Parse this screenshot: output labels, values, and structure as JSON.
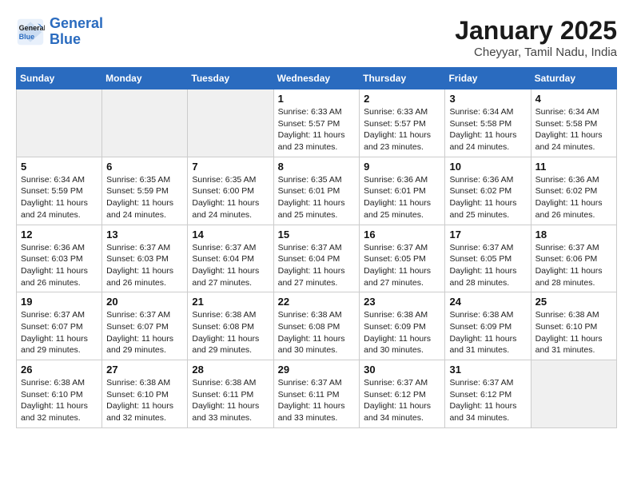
{
  "header": {
    "logo_line1": "General",
    "logo_line2": "Blue",
    "month_title": "January 2025",
    "subtitle": "Cheyyar, Tamil Nadu, India"
  },
  "weekdays": [
    "Sunday",
    "Monday",
    "Tuesday",
    "Wednesday",
    "Thursday",
    "Friday",
    "Saturday"
  ],
  "weeks": [
    [
      {
        "day": "",
        "info": "",
        "shaded": true
      },
      {
        "day": "",
        "info": "",
        "shaded": true
      },
      {
        "day": "",
        "info": "",
        "shaded": true
      },
      {
        "day": "1",
        "info": "Sunrise: 6:33 AM\nSunset: 5:57 PM\nDaylight: 11 hours\nand 23 minutes."
      },
      {
        "day": "2",
        "info": "Sunrise: 6:33 AM\nSunset: 5:57 PM\nDaylight: 11 hours\nand 23 minutes."
      },
      {
        "day": "3",
        "info": "Sunrise: 6:34 AM\nSunset: 5:58 PM\nDaylight: 11 hours\nand 24 minutes."
      },
      {
        "day": "4",
        "info": "Sunrise: 6:34 AM\nSunset: 5:58 PM\nDaylight: 11 hours\nand 24 minutes."
      }
    ],
    [
      {
        "day": "5",
        "info": "Sunrise: 6:34 AM\nSunset: 5:59 PM\nDaylight: 11 hours\nand 24 minutes."
      },
      {
        "day": "6",
        "info": "Sunrise: 6:35 AM\nSunset: 5:59 PM\nDaylight: 11 hours\nand 24 minutes."
      },
      {
        "day": "7",
        "info": "Sunrise: 6:35 AM\nSunset: 6:00 PM\nDaylight: 11 hours\nand 24 minutes."
      },
      {
        "day": "8",
        "info": "Sunrise: 6:35 AM\nSunset: 6:01 PM\nDaylight: 11 hours\nand 25 minutes."
      },
      {
        "day": "9",
        "info": "Sunrise: 6:36 AM\nSunset: 6:01 PM\nDaylight: 11 hours\nand 25 minutes."
      },
      {
        "day": "10",
        "info": "Sunrise: 6:36 AM\nSunset: 6:02 PM\nDaylight: 11 hours\nand 25 minutes."
      },
      {
        "day": "11",
        "info": "Sunrise: 6:36 AM\nSunset: 6:02 PM\nDaylight: 11 hours\nand 26 minutes."
      }
    ],
    [
      {
        "day": "12",
        "info": "Sunrise: 6:36 AM\nSunset: 6:03 PM\nDaylight: 11 hours\nand 26 minutes."
      },
      {
        "day": "13",
        "info": "Sunrise: 6:37 AM\nSunset: 6:03 PM\nDaylight: 11 hours\nand 26 minutes."
      },
      {
        "day": "14",
        "info": "Sunrise: 6:37 AM\nSunset: 6:04 PM\nDaylight: 11 hours\nand 27 minutes."
      },
      {
        "day": "15",
        "info": "Sunrise: 6:37 AM\nSunset: 6:04 PM\nDaylight: 11 hours\nand 27 minutes."
      },
      {
        "day": "16",
        "info": "Sunrise: 6:37 AM\nSunset: 6:05 PM\nDaylight: 11 hours\nand 27 minutes."
      },
      {
        "day": "17",
        "info": "Sunrise: 6:37 AM\nSunset: 6:05 PM\nDaylight: 11 hours\nand 28 minutes."
      },
      {
        "day": "18",
        "info": "Sunrise: 6:37 AM\nSunset: 6:06 PM\nDaylight: 11 hours\nand 28 minutes."
      }
    ],
    [
      {
        "day": "19",
        "info": "Sunrise: 6:37 AM\nSunset: 6:07 PM\nDaylight: 11 hours\nand 29 minutes."
      },
      {
        "day": "20",
        "info": "Sunrise: 6:37 AM\nSunset: 6:07 PM\nDaylight: 11 hours\nand 29 minutes."
      },
      {
        "day": "21",
        "info": "Sunrise: 6:38 AM\nSunset: 6:08 PM\nDaylight: 11 hours\nand 29 minutes."
      },
      {
        "day": "22",
        "info": "Sunrise: 6:38 AM\nSunset: 6:08 PM\nDaylight: 11 hours\nand 30 minutes."
      },
      {
        "day": "23",
        "info": "Sunrise: 6:38 AM\nSunset: 6:09 PM\nDaylight: 11 hours\nand 30 minutes."
      },
      {
        "day": "24",
        "info": "Sunrise: 6:38 AM\nSunset: 6:09 PM\nDaylight: 11 hours\nand 31 minutes."
      },
      {
        "day": "25",
        "info": "Sunrise: 6:38 AM\nSunset: 6:10 PM\nDaylight: 11 hours\nand 31 minutes."
      }
    ],
    [
      {
        "day": "26",
        "info": "Sunrise: 6:38 AM\nSunset: 6:10 PM\nDaylight: 11 hours\nand 32 minutes."
      },
      {
        "day": "27",
        "info": "Sunrise: 6:38 AM\nSunset: 6:10 PM\nDaylight: 11 hours\nand 32 minutes."
      },
      {
        "day": "28",
        "info": "Sunrise: 6:38 AM\nSunset: 6:11 PM\nDaylight: 11 hours\nand 33 minutes."
      },
      {
        "day": "29",
        "info": "Sunrise: 6:37 AM\nSunset: 6:11 PM\nDaylight: 11 hours\nand 33 minutes."
      },
      {
        "day": "30",
        "info": "Sunrise: 6:37 AM\nSunset: 6:12 PM\nDaylight: 11 hours\nand 34 minutes."
      },
      {
        "day": "31",
        "info": "Sunrise: 6:37 AM\nSunset: 6:12 PM\nDaylight: 11 hours\nand 34 minutes."
      },
      {
        "day": "",
        "info": "",
        "shaded": true
      }
    ]
  ]
}
